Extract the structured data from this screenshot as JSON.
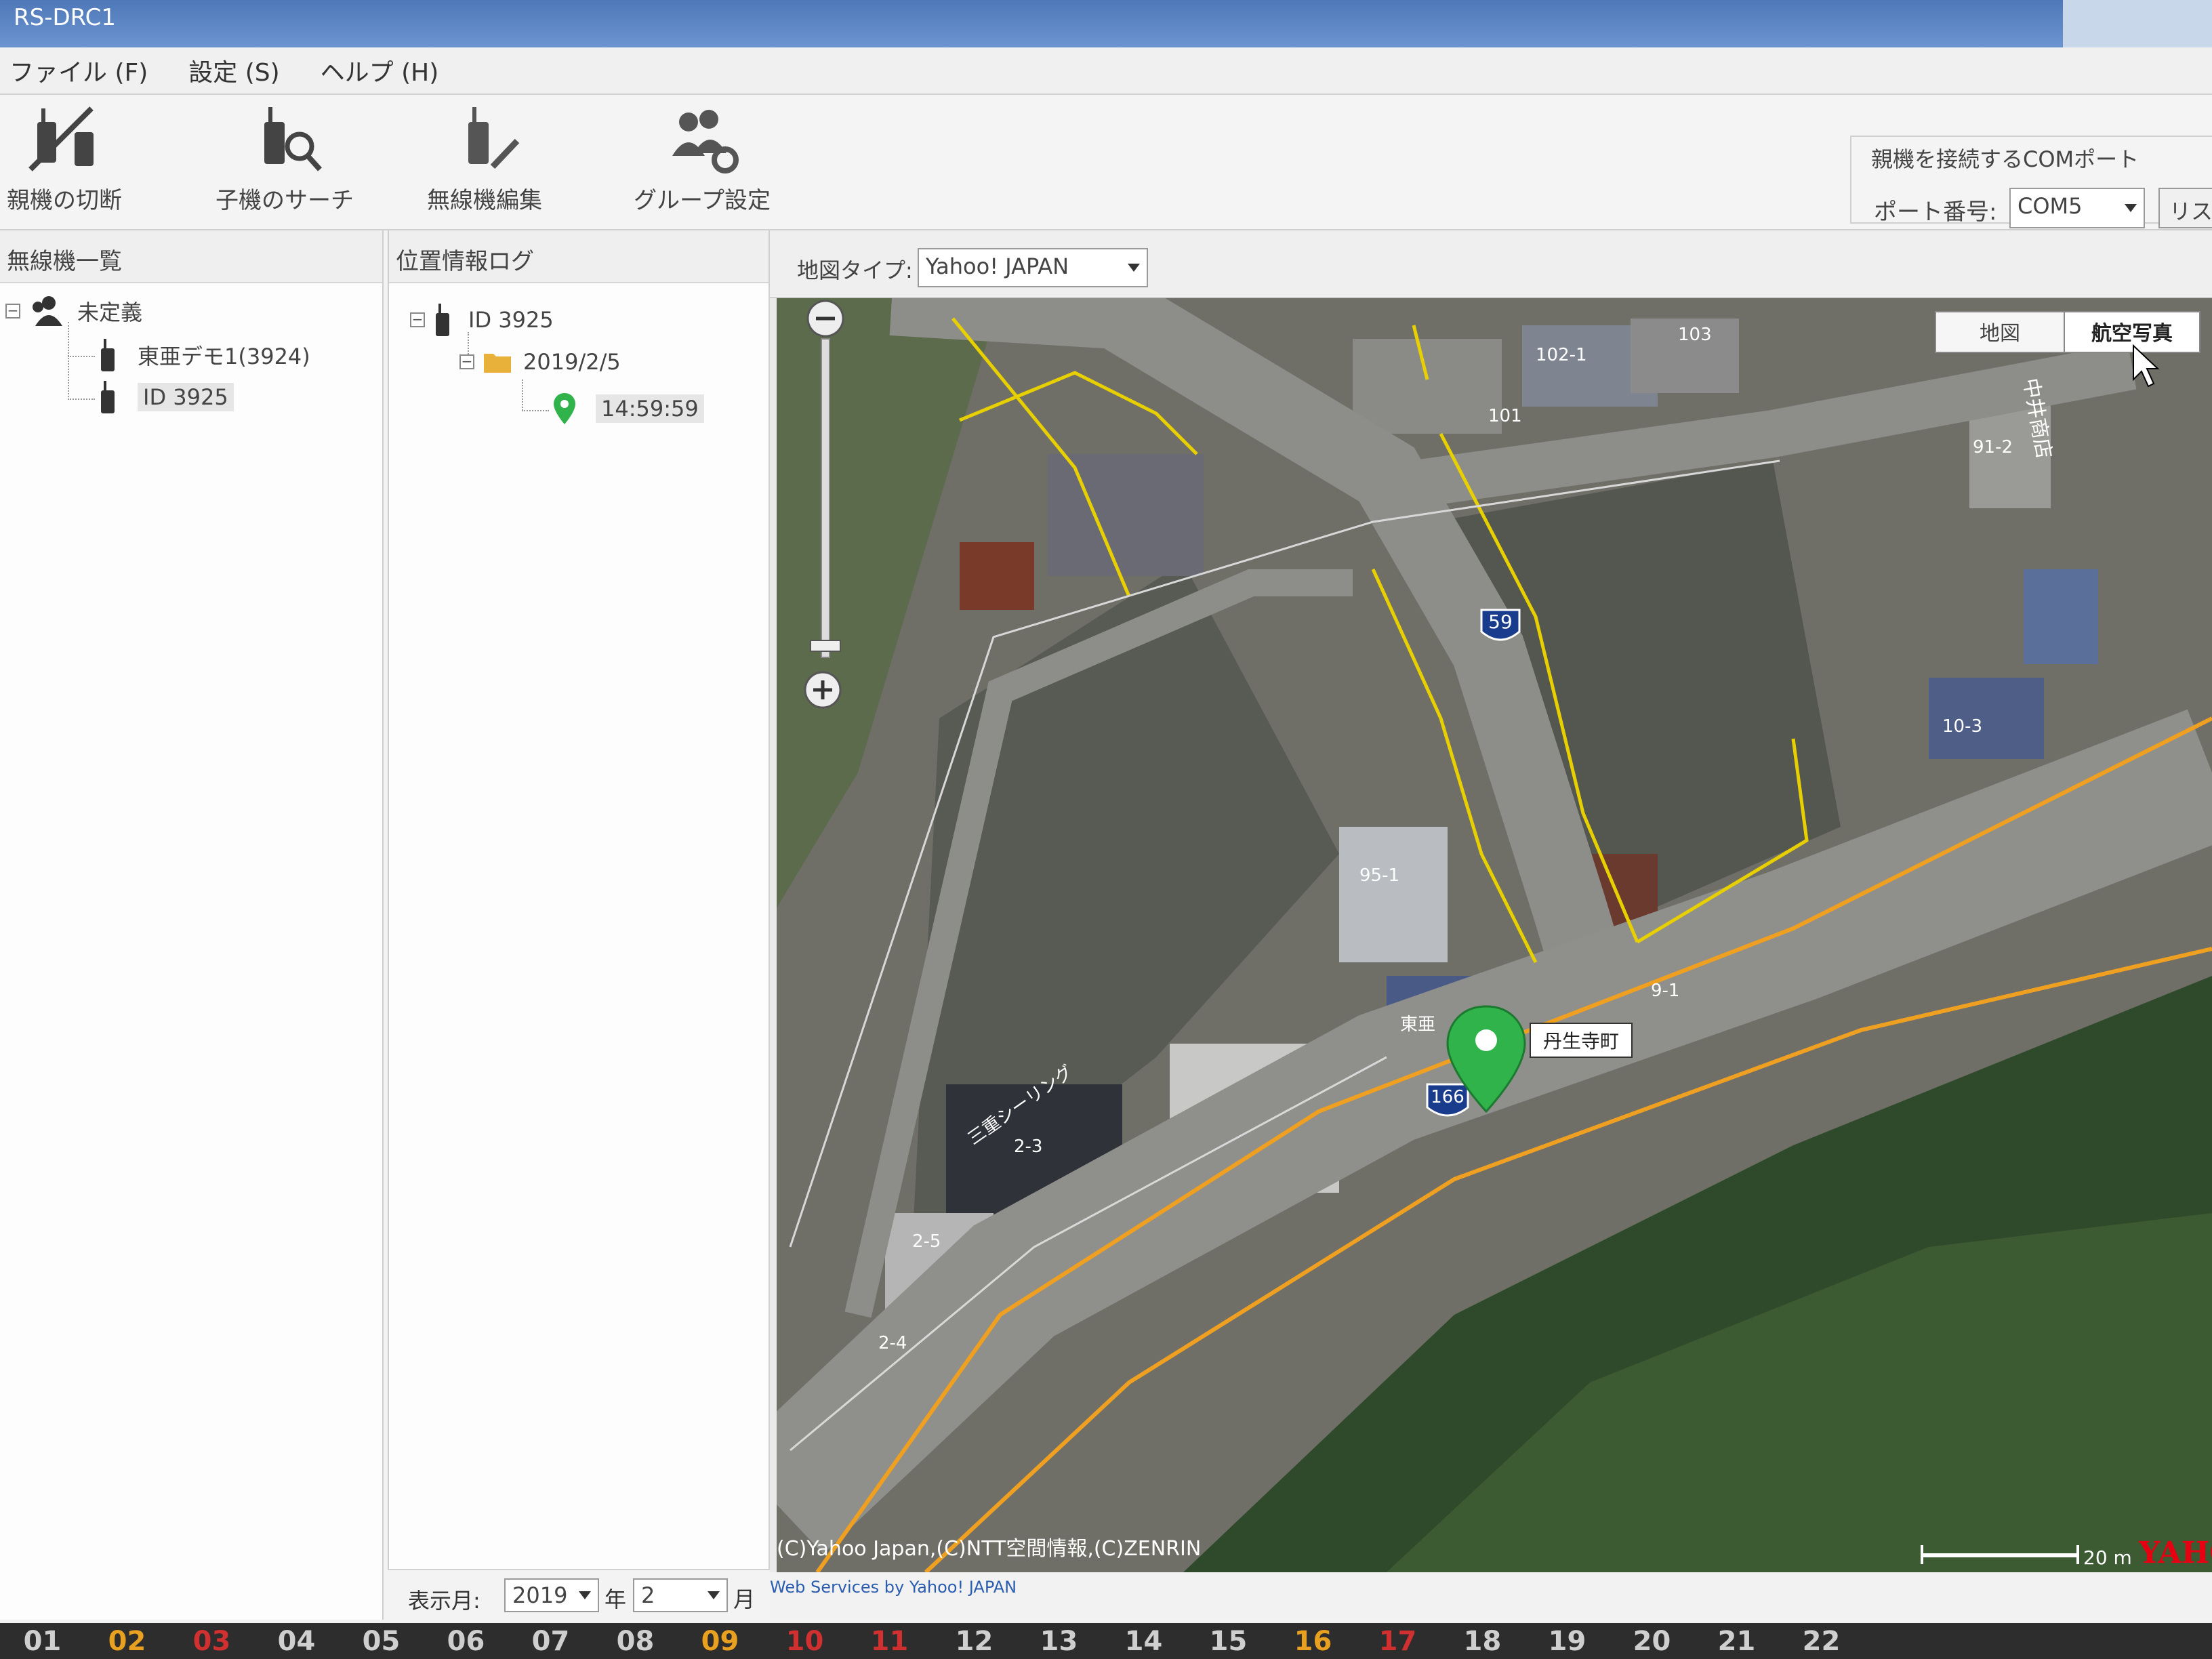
{
  "window": {
    "title": "RS-DRC1"
  },
  "menu": [
    "ファイル (F)",
    "設定 (S)",
    "ヘルプ (H)"
  ],
  "toolbar": {
    "switch_parent": "親機の切断",
    "search_child": "子機のサーチ",
    "edit_radio": "無線機編集",
    "group_settings": "グループ設定"
  },
  "com_port": {
    "group_title": "親機を接続するCOMポート",
    "port_label": "ポート番号:",
    "port_value": "COM5",
    "list_button": "リス"
  },
  "radio_list": {
    "header": "無線機一覧",
    "group_name": "未定義",
    "items": [
      "東亜デモ1(3924)",
      "ID 3925"
    ]
  },
  "location_log": {
    "header": "位置情報ログ",
    "device": "ID 3925",
    "date": "2019/2/5",
    "time": "14:59:59"
  },
  "map": {
    "type_label": "地図タイプ:",
    "type_value": "Yahoo! JAPAN",
    "btn_map": "地図",
    "btn_aerial": "航空写真",
    "marker_label": "丹生寺町",
    "route_59": "59",
    "route_166": "166",
    "labels": {
      "b102": "102-1",
      "b103": "103",
      "b101": "101",
      "b91": "91-2",
      "shop": "中井商店",
      "b95": "95-1",
      "b103b": "10-3",
      "b91b": "9-1",
      "toa": "東亜",
      "seal": "三重シーリング",
      "b23": "2-3",
      "b25": "2-5",
      "b24": "2-4"
    },
    "copyright": "(C)Yahoo Japan,(C)NTT空間情報,(C)ZENRIN",
    "webservices": "Web Services by Yahoo! JAPAN",
    "scale": "20 m",
    "logo": "YAHO"
  },
  "display_month": {
    "label": "表示月:",
    "year": "2019",
    "year_unit": "年",
    "month": "2",
    "month_unit": "月"
  },
  "month_strip": [
    "01",
    "02",
    "03",
    "04",
    "05",
    "06",
    "07",
    "08",
    "09",
    "10",
    "11",
    "12",
    "13",
    "14",
    "15",
    "16",
    "17",
    "18",
    "19",
    "20",
    "21",
    "22"
  ],
  "colors": {
    "accent": "#4f78b8",
    "road_edge": "#f0a020",
    "parcel": "#e8d000",
    "marker": "#2fb34a"
  }
}
